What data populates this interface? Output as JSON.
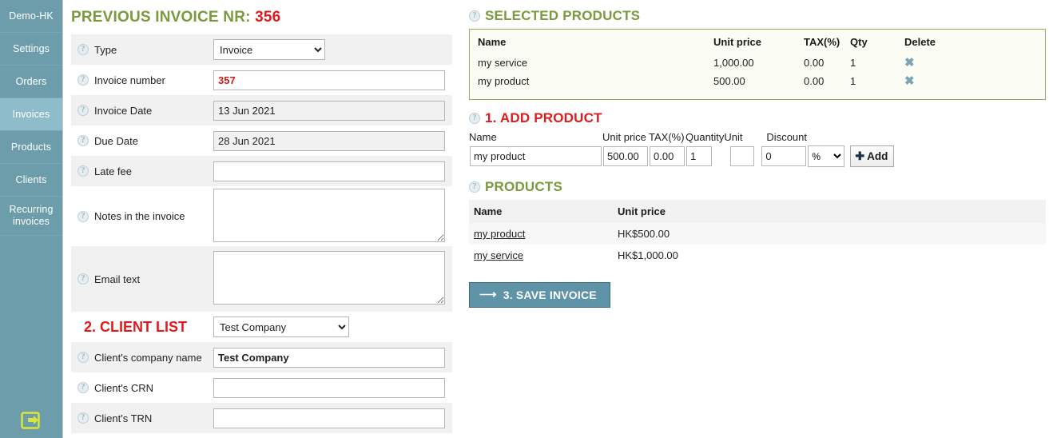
{
  "sidebar": {
    "items": [
      {
        "label": "Demo-HK",
        "active": false,
        "name": "sidebar-item-demo-hk"
      },
      {
        "label": "Settings",
        "active": false,
        "name": "sidebar-item-settings"
      },
      {
        "label": "Orders",
        "active": false,
        "name": "sidebar-item-orders"
      },
      {
        "label": "Invoices",
        "active": true,
        "name": "sidebar-item-invoices"
      },
      {
        "label": "Products",
        "active": false,
        "name": "sidebar-item-products"
      },
      {
        "label": "Clients",
        "active": false,
        "name": "sidebar-item-clients"
      },
      {
        "label": "Recurring invoices",
        "active": false,
        "name": "sidebar-item-recurring-invoices"
      }
    ],
    "bottom_icon": "exit-icon",
    "bg_color": "#6d9cab",
    "active_bg_color": "#8fbccb",
    "icon_color": "#d8e63a"
  },
  "invoice_form": {
    "title_prefix": "PREVIOUS INVOICE NR:",
    "title_number": "356",
    "title_color": "#7a9a3d",
    "title_number_color": "#e11b1b",
    "help_icon": "question-mark-icon",
    "fields": {
      "type": {
        "label": "Type",
        "value": "Invoice",
        "options": [
          "Invoice"
        ]
      },
      "invoice_number": {
        "label": "Invoice number",
        "value": "357"
      },
      "invoice_date": {
        "label": "Invoice Date",
        "value": "13 Jun 2021"
      },
      "due_date": {
        "label": "Due Date",
        "value": "28 Jun 2021"
      },
      "late_fee": {
        "label": "Late fee",
        "value": ""
      },
      "notes": {
        "label": "Notes in the invoice",
        "value": ""
      },
      "email_text": {
        "label": "Email text",
        "value": ""
      },
      "client_company_name": {
        "label": "Client's company name",
        "value": "Test Company"
      },
      "client_crn": {
        "label": "Client's CRN",
        "value": ""
      },
      "client_trn": {
        "label": "Client's TRN",
        "value": ""
      }
    },
    "client_list": {
      "title": "2. CLIENT LIST",
      "selected": "Test Company",
      "options": [
        "Test Company"
      ]
    }
  },
  "selected_products": {
    "heading": "SELECTED PRODUCTS",
    "heading_color": "#7a9a3d",
    "columns": [
      "Name",
      "Unit price",
      "TAX(%)",
      "Qty",
      "Delete"
    ],
    "rows": [
      {
        "name": "my service",
        "unit_price": "1,000.00",
        "tax": "0.00",
        "qty": "1",
        "delete_icon": "x-mark-icon"
      },
      {
        "name": "my product",
        "unit_price": "500.00",
        "tax": "0.00",
        "qty": "1",
        "delete_icon": "x-mark-icon"
      }
    ]
  },
  "add_product": {
    "heading": "1. ADD PRODUCT",
    "heading_color": "#e11b1b",
    "labels": {
      "name": "Name",
      "unit_price": "Unit price",
      "tax": "TAX(%)",
      "quantity": "Quantity",
      "unit": "Unit",
      "discount": "Discount"
    },
    "values": {
      "name": "my product",
      "unit_price": "500.00",
      "tax": "0.00",
      "quantity": "1",
      "unit": "",
      "discount": "0",
      "discount_type": "%"
    },
    "discount_options": [
      "%"
    ],
    "add_button": "Add",
    "add_button_icon": "plus-icon"
  },
  "products": {
    "heading": "PRODUCTS",
    "heading_color": "#7a9a3d",
    "columns": [
      "Name",
      "Unit price"
    ],
    "rows": [
      {
        "name": "my product",
        "unit_price": "HK$500.00"
      },
      {
        "name": "my service",
        "unit_price": "HK$1,000.00"
      }
    ]
  },
  "save_invoice": {
    "label": "3. SAVE INVOICE",
    "icon": "arrow-right-icon",
    "bg_color": "#5f93a8"
  }
}
